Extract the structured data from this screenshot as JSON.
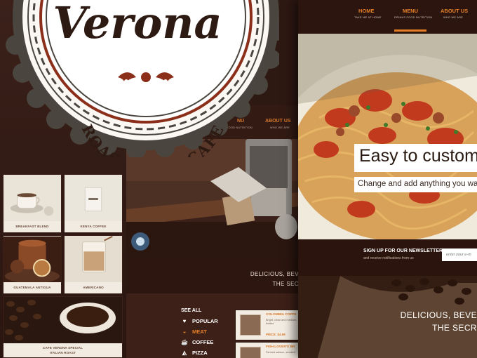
{
  "logo": {
    "name": "Verona",
    "tagline": "ROASTERS & CAFE"
  },
  "left_panel": {
    "tiles": [
      {
        "caption": "BREAKFAST BLEND"
      },
      {
        "caption": "KENYA COFFEE"
      },
      {
        "caption": "GUATEMALA ANTIGUA"
      },
      {
        "caption": "AMERICANO"
      },
      {
        "caption_line1": "CAFE VERONA SPECIAL",
        "caption_line2": "ITALIAN ROAST"
      }
    ]
  },
  "middle_panel": {
    "nav": [
      {
        "label": "NU",
        "sub": "FOOD NUTRITION"
      },
      {
        "label": "ABOUT US",
        "sub": "WHO WE ARE"
      }
    ],
    "tagline_line1": "DELICIOUS, BEV",
    "tagline_line2": "THE SEC",
    "categories_heading": "SEE ALL",
    "categories": [
      {
        "label": "POPULAR",
        "icon": "heart-icon",
        "active": false
      },
      {
        "label": "MEAT",
        "icon": "bowl-icon",
        "active": true
      },
      {
        "label": "COFFEE",
        "icon": "cup-icon",
        "active": false
      },
      {
        "label": "PIZZA",
        "icon": "pizza-icon",
        "active": false
      }
    ],
    "menu_cards": [
      {
        "title": "COLOMBIA COFFE",
        "desc": "Bright, clean and medium-bodied",
        "price": "PRICE: $4.99"
      },
      {
        "title": "FISH LOVER'S BR",
        "desc": "Farmed salmon, smoked"
      }
    ]
  },
  "right_panel": {
    "nav": [
      {
        "label": "HOME",
        "sub": "TAKE ME AT HOME"
      },
      {
        "label": "MENU",
        "sub": "DRINKS FOOD NUTRITION",
        "active": true
      },
      {
        "label": "ABOUT US",
        "sub": "WHO WE ARE"
      }
    ],
    "hero_title": "Easy to custom",
    "hero_subtitle": "Change and add anything you want ea",
    "newsletter": {
      "title": "SIGN UP FOR OUR NEWSLETTER",
      "subtitle": "and receive notifications from us",
      "placeholder": "enter your e-m"
    },
    "tagline_line1": "DELICIOUS, BEVE",
    "tagline_line2": "THE SECR"
  },
  "colors": {
    "accent": "#e57f26",
    "dark_brown": "#2e1710",
    "badge_red": "#8b2e1a",
    "cream": "#f3ece2"
  }
}
